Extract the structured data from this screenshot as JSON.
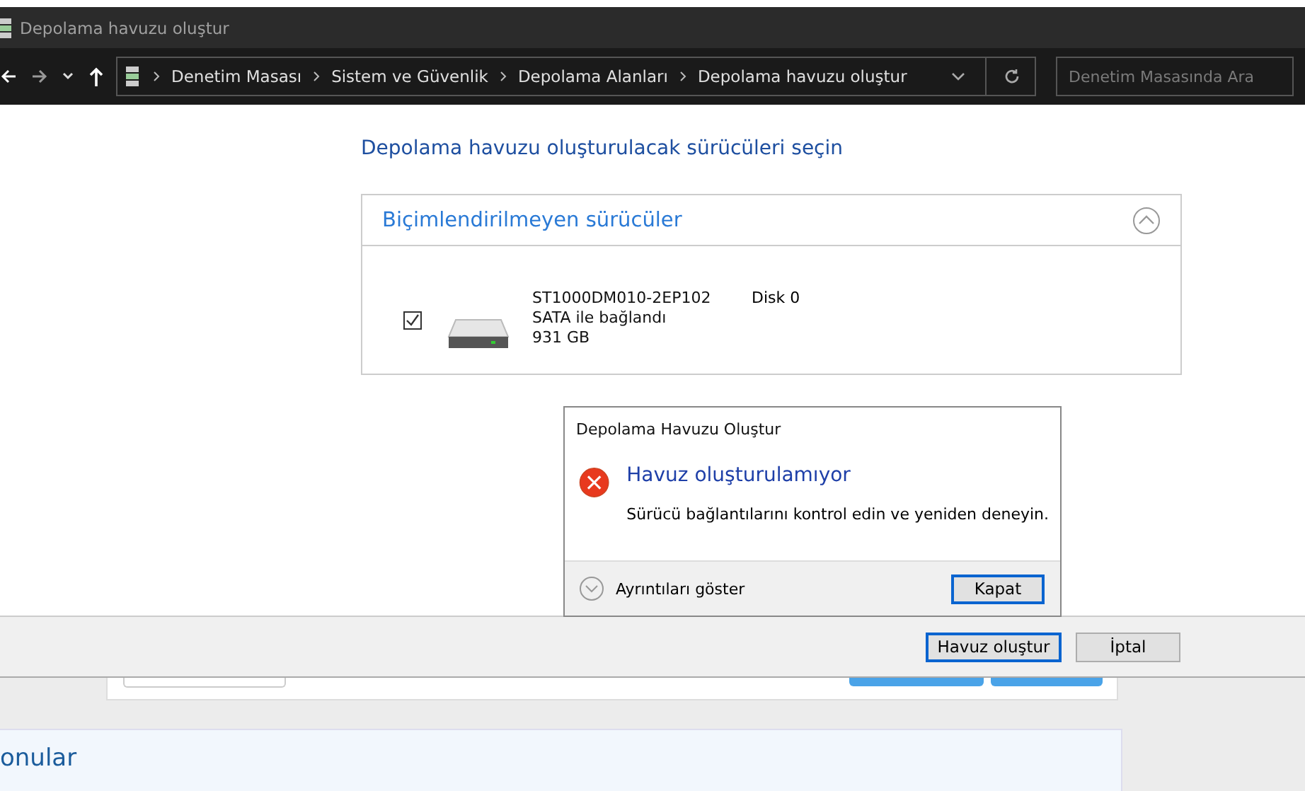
{
  "window": {
    "title": "Depolama havuzu oluştur"
  },
  "address_bar": {
    "crumbs": [
      "Denetim Masası",
      "Sistem ve Güvenlik",
      "Depolama Alanları",
      "Depolama havuzu oluştur"
    ]
  },
  "search": {
    "placeholder": "Denetim Masasında Ara"
  },
  "heading": "Depolama havuzu oluşturulacak sürücüleri seçin",
  "group": {
    "title": "Biçimlendirilmeyen sürücüler",
    "expanded": true,
    "drives": [
      {
        "name": "ST1000DM010-2EP102",
        "connection": "SATA ile bağlandı",
        "size": "931 GB",
        "disk": "Disk 0",
        "checked": true
      }
    ]
  },
  "dialog": {
    "title": "Depolama Havuzu Oluştur",
    "message": "Havuz oluşturulamıyor",
    "detail": "Sürücü bağlantılarını kontrol edin ve yeniden deneyin.",
    "details_toggle": "Ayrıntıları göster",
    "button": "Kapat"
  },
  "footer_buttons": [
    {
      "label": "Havuz oluştur",
      "selected": true
    },
    {
      "label": "İptal",
      "selected": false
    }
  ],
  "background_page": {
    "section_title": "onular"
  }
}
